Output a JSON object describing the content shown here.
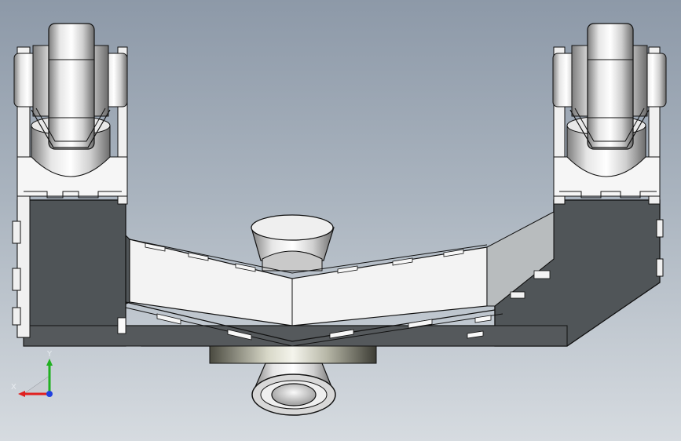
{
  "viewport": {
    "background_top": "#8d99a8",
    "background_bottom": "#d6dbe0"
  },
  "model": {
    "body_color": "#505558",
    "panel_color": "#f2f2f2",
    "metal_color": "#c8c8c8",
    "edge_color": "#111111"
  },
  "triad": {
    "x_label": "X",
    "y_label": "Y",
    "x_color": "#e02020",
    "y_color": "#20b020",
    "z_color": "#2040e0"
  }
}
